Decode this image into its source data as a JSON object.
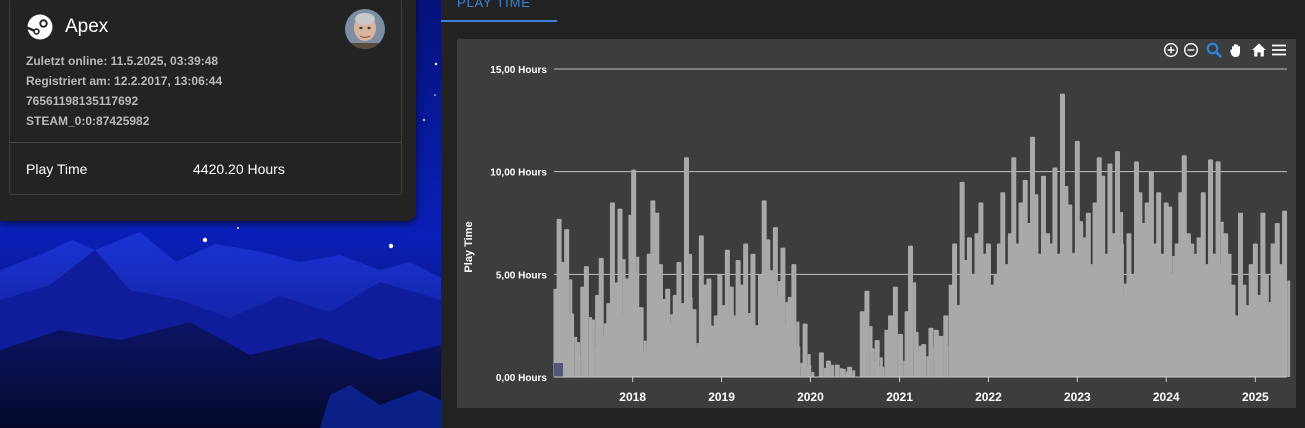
{
  "tab": {
    "label": "PLAY TIME"
  },
  "profile": {
    "game_title": "Apex",
    "last_online": "Zuletzt online: 11.5.2025, 03:39:48",
    "registered": "Registriert am: 12.2.2017, 13:06:44",
    "steam_id64": "76561198135117692",
    "steam_id": "STEAM_0:0:87425982",
    "play_time_label": "Play Time",
    "play_time_value": "4420.20 Hours"
  },
  "toolbar": {
    "icons": [
      "zoom-in-icon",
      "zoom-out-icon",
      "zoom-select-icon",
      "pan-hand-icon",
      "reset-home-icon",
      "menu-icon"
    ],
    "active_icon": "zoom-select-icon"
  },
  "colors": {
    "accent": "#3b82d6",
    "bars": "#a9a9a9",
    "plot_bg": "#3d3d3d",
    "card_bg": "#232323",
    "gridline": "#d8d8d8"
  },
  "chart_data": {
    "type": "bar",
    "title": "",
    "xlabel": "",
    "ylabel": "Play Time",
    "ylim": [
      0,
      15
    ],
    "yticks": [
      0,
      5,
      10,
      15
    ],
    "ytick_labels": [
      "0,00 Hours",
      "5,00 Hours",
      "10,00 Hours",
      "15,00 Hours"
    ],
    "xlim": [
      "2017-02-12",
      "2025-05-11"
    ],
    "xticks": [
      "2018-01-01",
      "2019-01-01",
      "2020-01-01",
      "2021-01-01",
      "2022-01-01",
      "2023-01-01",
      "2024-01-01",
      "2025-01-01"
    ],
    "xtick_labels": [
      "2018",
      "2019",
      "2020",
      "2021",
      "2022",
      "2023",
      "2024",
      "2025"
    ],
    "grid": "horizontal",
    "series": [
      {
        "values": [
          [
            "2017-02-20",
            4.3
          ],
          [
            "2017-03-05",
            7.7
          ],
          [
            "2017-03-20",
            5.6
          ],
          [
            "2017-04-05",
            7.2
          ],
          [
            "2017-04-25",
            3.1
          ],
          [
            "2017-05-20",
            1.7
          ],
          [
            "2017-06-10",
            4.4
          ],
          [
            "2017-06-25",
            5.4
          ],
          [
            "2017-07-20",
            2.8
          ],
          [
            "2017-08-10",
            4.0
          ],
          [
            "2017-08-25",
            5.8
          ],
          [
            "2017-09-10",
            2.0
          ],
          [
            "2017-09-25",
            3.6
          ],
          [
            "2017-10-10",
            8.5
          ],
          [
            "2017-10-25",
            4.6
          ],
          [
            "2017-11-10",
            8.2
          ],
          [
            "2017-11-25",
            3.0
          ],
          [
            "2017-12-10",
            4.8
          ],
          [
            "2017-12-25",
            7.9
          ],
          [
            "2018-01-05",
            10.1
          ],
          [
            "2018-01-15",
            5.1
          ],
          [
            "2018-02-05",
            3.4
          ],
          [
            "2018-02-20",
            1.2
          ],
          [
            "2018-03-10",
            6.0
          ],
          [
            "2018-03-25",
            8.6
          ],
          [
            "2018-04-10",
            8.0
          ],
          [
            "2018-04-25",
            5.5
          ],
          [
            "2018-05-10",
            3.8
          ],
          [
            "2018-05-25",
            4.3
          ],
          [
            "2018-06-10",
            2.6
          ],
          [
            "2018-06-25",
            4.0
          ],
          [
            "2018-07-10",
            5.6
          ],
          [
            "2018-07-25",
            3.6
          ],
          [
            "2018-08-10",
            10.7
          ],
          [
            "2018-08-25",
            3.9
          ],
          [
            "2018-09-10",
            3.3
          ],
          [
            "2018-09-25",
            1.5
          ],
          [
            "2018-10-10",
            6.9
          ],
          [
            "2018-10-25",
            4.5
          ],
          [
            "2018-11-10",
            4.8
          ],
          [
            "2018-11-25",
            2.5
          ],
          [
            "2018-12-10",
            3.0
          ],
          [
            "2018-12-25",
            5.0
          ],
          [
            "2019-01-10",
            3.5
          ],
          [
            "2019-01-25",
            6.2
          ],
          [
            "2019-02-10",
            4.4
          ],
          [
            "2019-02-25",
            3.0
          ],
          [
            "2019-03-10",
            5.7
          ],
          [
            "2019-03-25",
            4.5
          ],
          [
            "2019-04-10",
            6.5
          ],
          [
            "2019-04-25",
            3.0
          ],
          [
            "2019-05-10",
            6.0
          ],
          [
            "2019-05-25",
            2.5
          ],
          [
            "2019-06-10",
            5.0
          ],
          [
            "2019-06-25",
            8.6
          ],
          [
            "2019-07-10",
            6.7
          ],
          [
            "2019-07-25",
            5.2
          ],
          [
            "2019-08-10",
            7.3
          ],
          [
            "2019-08-25",
            4.0
          ],
          [
            "2019-09-10",
            6.3
          ],
          [
            "2019-09-25",
            2.5
          ],
          [
            "2019-10-10",
            3.9
          ],
          [
            "2019-10-25",
            5.5
          ],
          [
            "2019-11-10",
            1.5
          ],
          [
            "2019-12-10",
            2.6
          ],
          [
            "2019-12-25",
            0.6
          ],
          [
            "2020-02-15",
            1.2
          ],
          [
            "2020-03-15",
            0.8
          ],
          [
            "2020-04-20",
            0.6
          ],
          [
            "2020-05-15",
            0.4
          ],
          [
            "2020-06-10",
            0.5
          ],
          [
            "2020-08-01",
            3.2
          ],
          [
            "2020-08-20",
            4.2
          ],
          [
            "2020-09-10",
            1.4
          ],
          [
            "2020-10-01",
            1.8
          ],
          [
            "2020-10-20",
            0.5
          ],
          [
            "2020-11-10",
            2.3
          ],
          [
            "2020-11-25",
            3.0
          ],
          [
            "2020-12-15",
            4.4
          ],
          [
            "2021-01-05",
            2.1
          ],
          [
            "2021-02-01",
            3.2
          ],
          [
            "2021-02-15",
            6.4
          ],
          [
            "2021-03-10",
            2.2
          ],
          [
            "2021-03-25",
            1.3
          ],
          [
            "2021-04-10",
            1.6
          ],
          [
            "2021-05-10",
            2.4
          ],
          [
            "2021-06-01",
            2.3
          ],
          [
            "2021-06-20",
            2.0
          ],
          [
            "2021-07-10",
            3.0
          ],
          [
            "2021-08-01",
            4.5
          ],
          [
            "2021-08-15",
            6.5
          ],
          [
            "2021-09-01",
            3.5
          ],
          [
            "2021-09-15",
            9.5
          ],
          [
            "2021-10-01",
            5.7
          ],
          [
            "2021-10-15",
            6.8
          ],
          [
            "2021-11-01",
            5.0
          ],
          [
            "2021-11-15",
            7.0
          ],
          [
            "2021-12-01",
            8.5
          ],
          [
            "2021-12-15",
            6.0
          ],
          [
            "2022-01-01",
            6.5
          ],
          [
            "2022-01-15",
            4.5
          ],
          [
            "2022-02-01",
            5.0
          ],
          [
            "2022-02-15",
            6.5
          ],
          [
            "2022-03-01",
            9.0
          ],
          [
            "2022-03-15",
            5.5
          ],
          [
            "2022-04-01",
            7.0
          ],
          [
            "2022-04-15",
            10.7
          ],
          [
            "2022-05-01",
            6.5
          ],
          [
            "2022-05-15",
            8.5
          ],
          [
            "2022-06-01",
            9.6
          ],
          [
            "2022-06-15",
            7.5
          ],
          [
            "2022-07-01",
            11.7
          ],
          [
            "2022-07-15",
            8.9
          ],
          [
            "2022-08-01",
            6.0
          ],
          [
            "2022-08-15",
            9.8
          ],
          [
            "2022-09-01",
            7.0
          ],
          [
            "2022-09-15",
            6.5
          ],
          [
            "2022-10-01",
            10.2
          ],
          [
            "2022-10-15",
            6.0
          ],
          [
            "2022-11-01",
            13.8
          ],
          [
            "2022-11-15",
            9.3
          ],
          [
            "2022-12-01",
            8.4
          ],
          [
            "2022-12-15",
            6.0
          ],
          [
            "2023-01-01",
            11.5
          ],
          [
            "2023-01-15",
            7.5
          ],
          [
            "2023-02-01",
            6.8
          ],
          [
            "2023-02-15",
            8.0
          ],
          [
            "2023-03-01",
            5.5
          ],
          [
            "2023-03-15",
            8.5
          ],
          [
            "2023-04-01",
            10.7
          ],
          [
            "2023-04-15",
            9.8
          ],
          [
            "2023-05-01",
            6.0
          ],
          [
            "2023-05-15",
            10.4
          ],
          [
            "2023-06-01",
            7.0
          ],
          [
            "2023-06-15",
            11.0
          ],
          [
            "2023-07-01",
            6.5
          ],
          [
            "2023-07-15",
            4.0
          ],
          [
            "2023-08-01",
            7.0
          ],
          [
            "2023-08-15",
            5.0
          ],
          [
            "2023-09-01",
            10.5
          ],
          [
            "2023-09-15",
            9.0
          ],
          [
            "2023-10-01",
            7.5
          ],
          [
            "2023-10-15",
            8.5
          ],
          [
            "2023-11-01",
            10.0
          ],
          [
            "2023-11-15",
            6.5
          ],
          [
            "2023-12-01",
            9.0
          ],
          [
            "2023-12-15",
            6.0
          ],
          [
            "2024-01-01",
            8.5
          ],
          [
            "2024-01-15",
            8.3
          ],
          [
            "2024-02-01",
            5.0
          ],
          [
            "2024-02-15",
            6.5
          ],
          [
            "2024-03-01",
            9.0
          ],
          [
            "2024-03-15",
            10.8
          ],
          [
            "2024-04-01",
            7.0
          ],
          [
            "2024-04-15",
            6.5
          ],
          [
            "2024-05-01",
            6.0
          ],
          [
            "2024-05-15",
            6.8
          ],
          [
            "2024-06-01",
            9.0
          ],
          [
            "2024-06-15",
            5.5
          ],
          [
            "2024-07-01",
            10.6
          ],
          [
            "2024-07-15",
            6.0
          ],
          [
            "2024-08-01",
            10.5
          ],
          [
            "2024-08-15",
            5.5
          ],
          [
            "2024-09-01",
            7.0
          ],
          [
            "2024-09-15",
            6.0
          ],
          [
            "2024-10-01",
            4.5
          ],
          [
            "2024-10-15",
            3.0
          ],
          [
            "2024-11-01",
            8.0
          ],
          [
            "2024-11-15",
            4.5
          ],
          [
            "2024-12-01",
            3.5
          ],
          [
            "2024-12-15",
            5.5
          ],
          [
            "2025-01-01",
            6.5
          ],
          [
            "2025-01-15",
            4.0
          ],
          [
            "2025-02-01",
            8.0
          ],
          [
            "2025-02-15",
            5.0
          ],
          [
            "2025-03-01",
            3.5
          ],
          [
            "2025-03-15",
            6.5
          ],
          [
            "2025-04-01",
            7.5
          ],
          [
            "2025-04-15",
            5.5
          ],
          [
            "2025-05-01",
            8.1
          ]
        ]
      }
    ]
  }
}
